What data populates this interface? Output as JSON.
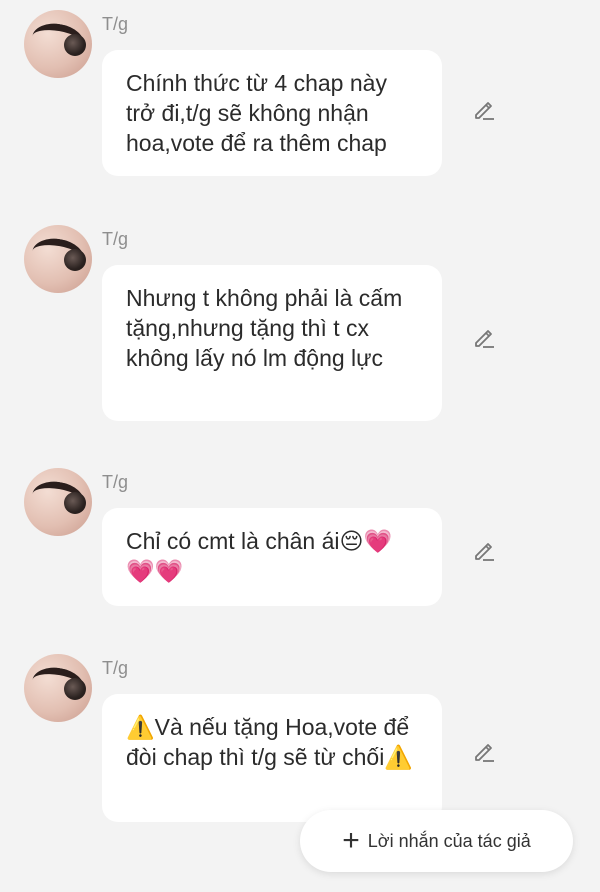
{
  "messages": [
    {
      "author": "T/g",
      "text": "Chính thức từ 4 chap này trở đi,t/g sẽ không nhận hoa,vote để ra thêm chap"
    },
    {
      "author": "T/g",
      "text": "Nhưng t không phải là cấm tặng,nhưng tặng thì t cx không lấy nó lm động lực"
    },
    {
      "author": "T/g",
      "text": "Chỉ có cmt là chân ái😔💗💗💗"
    },
    {
      "author": "T/g",
      "text": "⚠️Và nếu tặng Hoa,vote để đòi chap thì t/g sẽ từ chối⚠️"
    }
  ],
  "fab": {
    "icon": "plus-icon",
    "label": "Lời nhắn của tác giả"
  },
  "icons": {
    "edit": "pencil-edit-icon",
    "avatar": "author-avatar"
  }
}
